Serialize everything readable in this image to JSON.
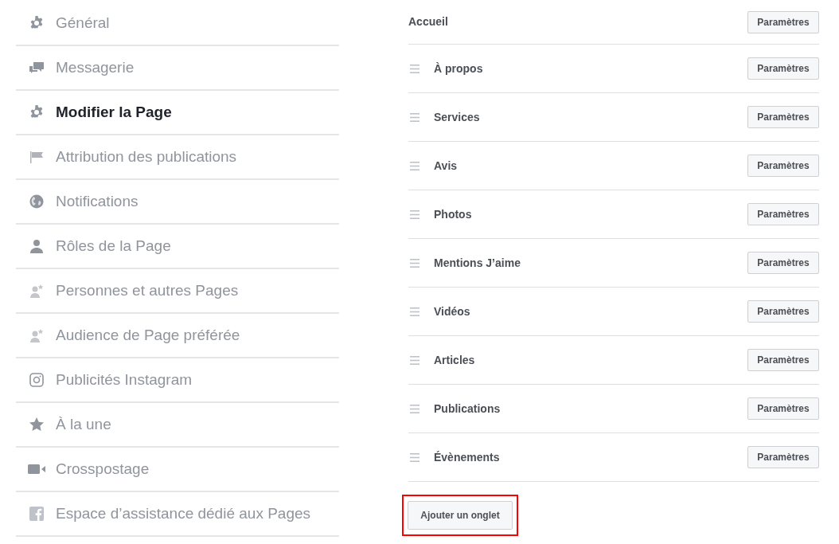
{
  "sidebar": {
    "items": [
      {
        "label": "Général",
        "kind": "gear",
        "selected": false
      },
      {
        "label": "Messagerie",
        "kind": "chat",
        "selected": false
      },
      {
        "label": "Modifier la Page",
        "kind": "gear",
        "selected": true
      },
      {
        "label": "Attribution des publications",
        "kind": "flag",
        "selected": false
      },
      {
        "label": "Notifications",
        "kind": "globe",
        "selected": false
      },
      {
        "label": "Rôles de la Page",
        "kind": "person",
        "selected": false
      },
      {
        "label": "Personnes et autres Pages",
        "kind": "personstar",
        "selected": false
      },
      {
        "label": "Audience de Page préférée",
        "kind": "personstar",
        "selected": false
      },
      {
        "label": "Publicités Instagram",
        "kind": "camera",
        "selected": false
      },
      {
        "label": "À la une",
        "kind": "star",
        "selected": false
      },
      {
        "label": "Crosspostage",
        "kind": "video",
        "selected": false
      },
      {
        "label": "Espace d’assistance dédié aux Pages",
        "kind": "facebook",
        "selected": false
      }
    ]
  },
  "tabs": {
    "rows": [
      {
        "label": "Accueil",
        "draggable": false,
        "button": "Paramètres"
      },
      {
        "label": "À propos",
        "draggable": true,
        "button": "Paramètres"
      },
      {
        "label": "Services",
        "draggable": true,
        "button": "Paramètres"
      },
      {
        "label": "Avis",
        "draggable": true,
        "button": "Paramètres"
      },
      {
        "label": "Photos",
        "draggable": true,
        "button": "Paramètres"
      },
      {
        "label": "Mentions J’aime",
        "draggable": true,
        "button": "Paramètres"
      },
      {
        "label": "Vidéos",
        "draggable": true,
        "button": "Paramètres"
      },
      {
        "label": "Articles",
        "draggable": true,
        "button": "Paramètres"
      },
      {
        "label": "Publications",
        "draggable": true,
        "button": "Paramètres"
      },
      {
        "label": "Évènements",
        "draggable": true,
        "button": "Paramètres"
      }
    ],
    "add_button": {
      "label": "Ajouter un onglet",
      "highlighted": true
    }
  }
}
